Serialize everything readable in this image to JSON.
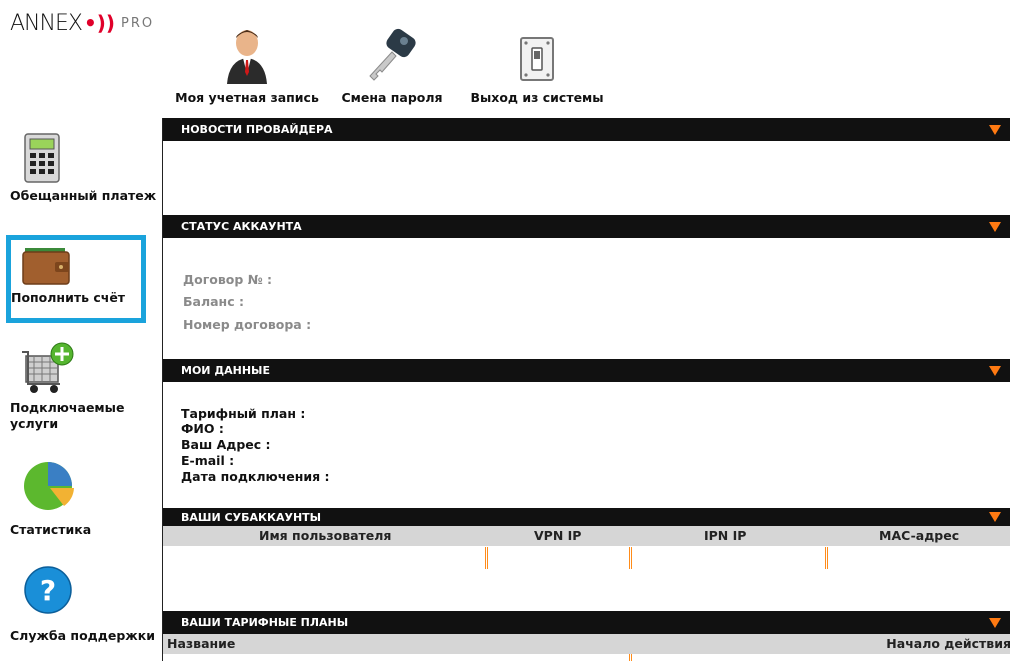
{
  "logo": {
    "brand": "ANNEX",
    "suffix": "PRO"
  },
  "topnav": [
    {
      "label": "Моя учетная запись",
      "icon": "user-account-icon"
    },
    {
      "label": "Смена пароля",
      "icon": "key-icon"
    },
    {
      "label": "Выход из системы",
      "icon": "power-switch-icon"
    }
  ],
  "sidebar": [
    {
      "label": "Обещанный платеж",
      "icon": "calculator-icon"
    },
    {
      "label": "Пополнить счёт",
      "icon": "wallet-icon",
      "selected": true
    },
    {
      "label": "Подключаемые услуги",
      "icon": "cart-add-icon"
    },
    {
      "label": "Статистика",
      "icon": "pie-chart-icon"
    },
    {
      "label": "Служба поддержки",
      "icon": "help-icon"
    }
  ],
  "sections": {
    "news": "НОВОСТИ ПРОВАЙДЕРА",
    "account_status": "СТАТУС АККАУНТА",
    "my_data": "МОИ ДАННЫЕ",
    "subaccounts": "ВАШИ СУБАККАУНТЫ",
    "tariff_plans": "ВАШИ ТАРИФНЫЕ ПЛАНЫ"
  },
  "account_status": {
    "contract": "Договор № :",
    "balance": "Баланс :",
    "contract_number": "Номер договора :"
  },
  "my_data": {
    "tariff": "Тарифный план :",
    "fio": "ФИО :",
    "address": "Ваш Адрес :",
    "email": "E-mail :",
    "connected": "Дата подключения :"
  },
  "subaccounts_columns": [
    "Имя пользователя",
    "VPN IP",
    "IPN IP",
    "MAC-адрес"
  ],
  "tariff_columns": [
    "Название",
    "Начало действия"
  ],
  "colors": {
    "accent": "#1aa3dc",
    "header": "#111111",
    "triangle": "#ff7a12",
    "table_head": "#d6d6d6"
  }
}
